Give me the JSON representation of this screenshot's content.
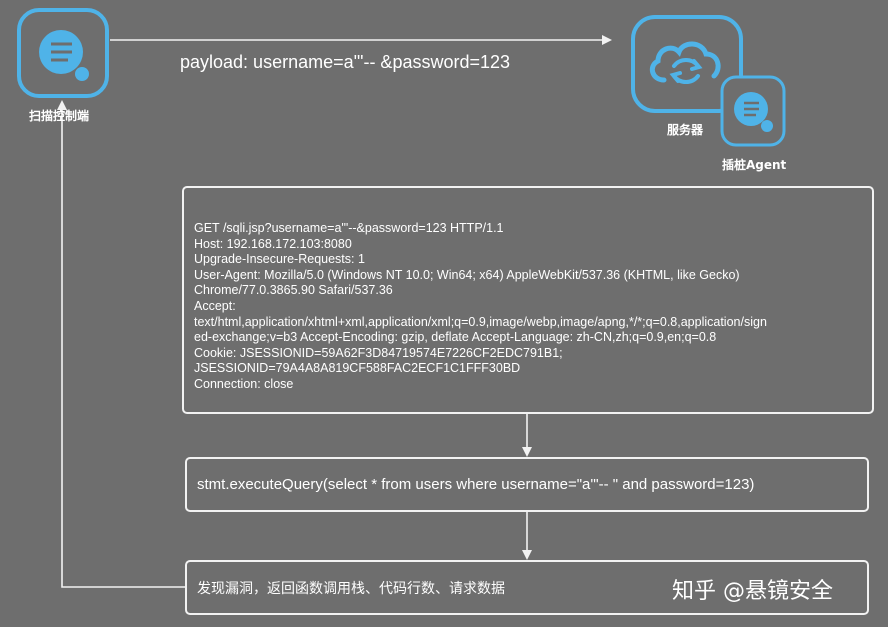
{
  "nodes": {
    "scanner_label": "扫描控制端",
    "server_label": "服务器",
    "agent_label": "插桩Agent"
  },
  "payload": "payload: username=a'\"-- &password=123",
  "request_lines": [
    "GET /sqli.jsp?username=a'\"--&password=123 HTTP/1.1",
    "Host: 192.168.172.103:8080",
    "Upgrade-Insecure-Requests: 1",
    "User-Agent: Mozilla/5.0 (Windows NT 10.0; Win64; x64) AppleWebKit/537.36 (KHTML, like Gecko)",
    "Chrome/77.0.3865.90 Safari/537.36",
    "Accept:",
    "text/html,application/xhtml+xml,application/xml;q=0.9,image/webp,image/apng,*/*;q=0.8,application/sign",
    "ed-exchange;v=b3 Accept-Encoding: gzip, deflate Accept-Language: zh-CN,zh;q=0.9,en;q=0.8",
    "Cookie: JSESSIONID=59A62F3D84719574E7226CF2EDC791B1;",
    "JSESSIONID=79A4A8A819CF588FAC2ECF1C1FFF30BD",
    "Connection: close"
  ],
  "query": "stmt.executeQuery(select * from users where username=\"a'\"-- \" and password=123)",
  "result": "发现漏洞，返回函数调用栈、代码行数、请求数据",
  "watermark": "知乎 @悬镜安全",
  "colors": {
    "background": "#6e6e6e",
    "icon_blue": "#4fb3e8",
    "line": "#f2f2f2"
  },
  "icons": [
    "search-app-icon",
    "cloud-sync-icon",
    "search-app-icon"
  ]
}
